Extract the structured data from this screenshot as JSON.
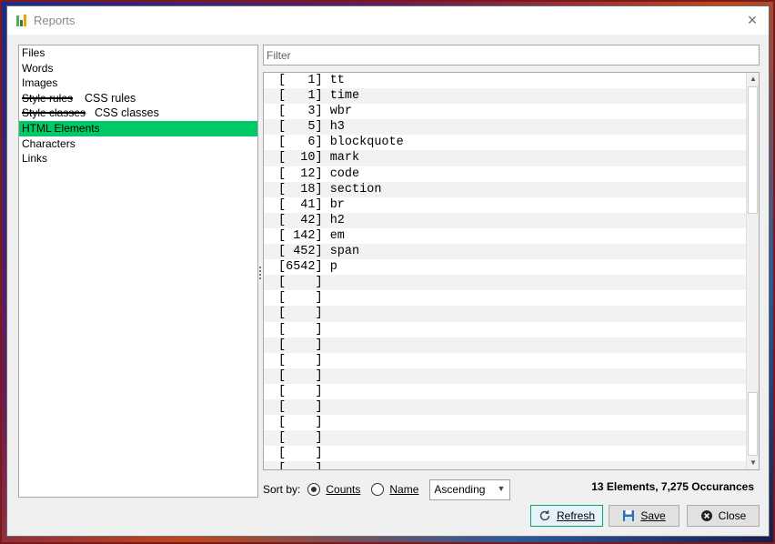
{
  "window": {
    "title": "Reports",
    "close_glyph": "×"
  },
  "left_panel": {
    "items": [
      {
        "label": "Files"
      },
      {
        "label": "Words"
      },
      {
        "label": "Images"
      },
      {
        "label": "Style rules",
        "annotation": "CSS rules"
      },
      {
        "label": "Style classes",
        "annotation": "CSS classes"
      },
      {
        "label": "HTML Elements"
      },
      {
        "label": "Characters"
      },
      {
        "label": "Links"
      }
    ],
    "selected": "HTML Elements"
  },
  "filter": {
    "placeholder": "Filter",
    "value": ""
  },
  "results": {
    "rows": [
      "[   1] tt",
      "[   1] time",
      "[   3] wbr",
      "[   5] h3",
      "[   6] blockquote",
      "[  10] mark",
      "[  12] code",
      "[  18] section",
      "[  41] br",
      "[  42] h2",
      "[ 142] em",
      "[ 452] span",
      "[6542] p",
      "[    ]",
      "[    ]",
      "[    ]",
      "[    ]",
      "[    ]",
      "[    ]",
      "[    ]",
      "[    ]",
      "[    ]",
      "[    ]",
      "[    ]",
      "[    ]",
      "[    ]",
      "[    ]"
    ]
  },
  "sort": {
    "label": "Sort by:",
    "options": [
      "Counts",
      "Name"
    ],
    "selected": "Counts",
    "order": "Ascending"
  },
  "summary": "13 Elements, 7,275 Occurances",
  "buttons": {
    "refresh": "Refresh",
    "save": "Save",
    "close": "Close"
  },
  "colors": {
    "selected_bg": "#00c967",
    "refresh_border": "#00a86b"
  }
}
